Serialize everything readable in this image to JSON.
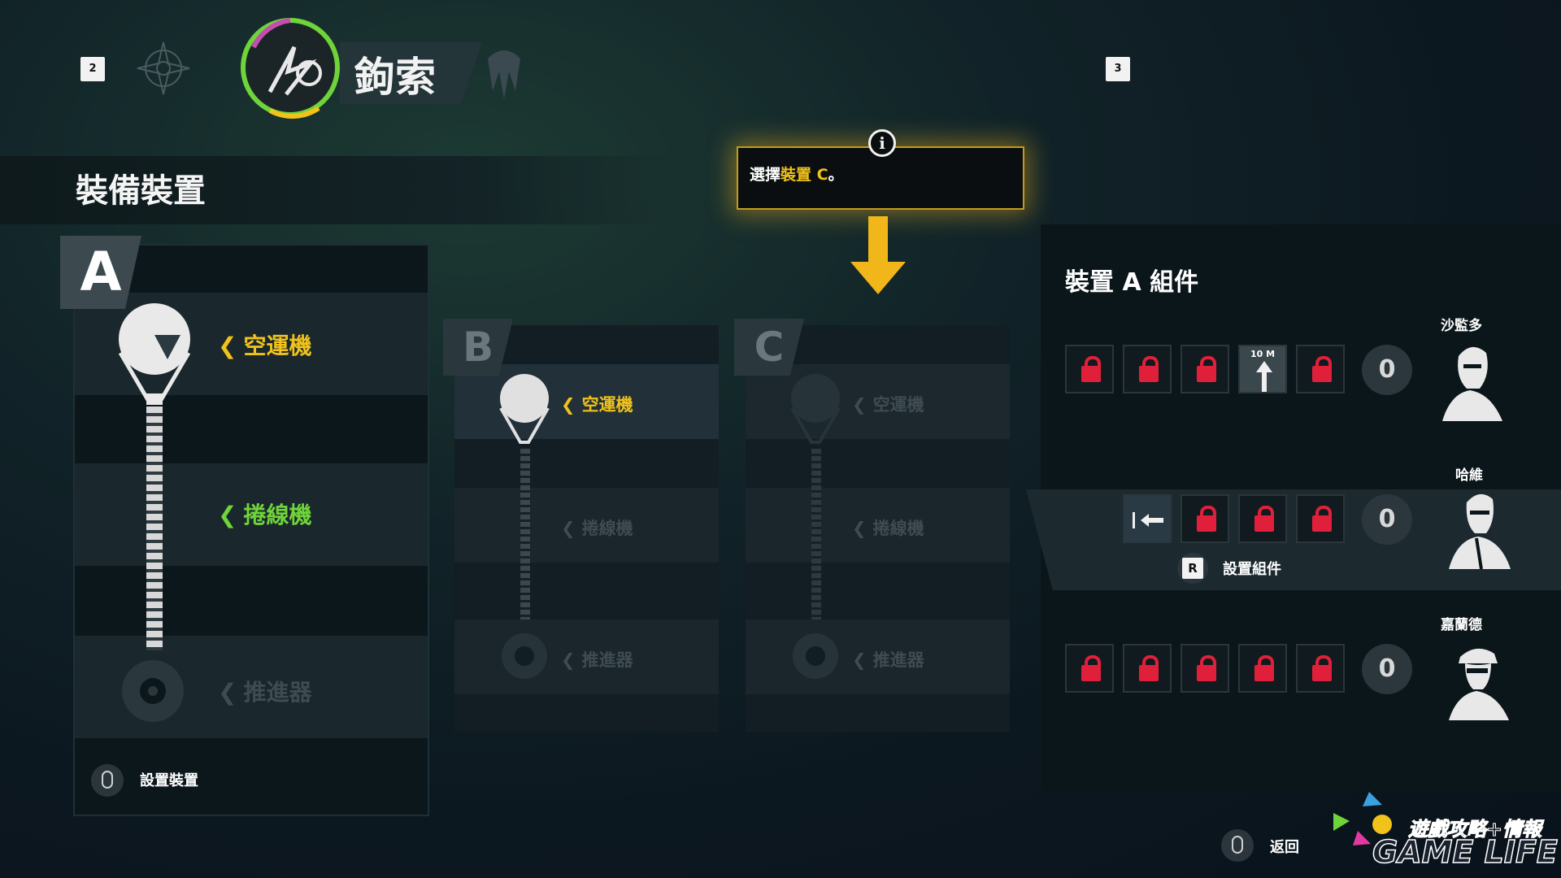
{
  "header": {
    "key_left": "2",
    "key_right": "3",
    "title": "鉤索"
  },
  "section_title": "裝備裝置",
  "tooltip": {
    "prefix": "選擇",
    "highlight": "裝置 C",
    "suffix": "。"
  },
  "device_a": {
    "letter": "A",
    "slots": [
      {
        "label": "空運機",
        "state": "yellow"
      },
      {
        "label": "捲線機",
        "state": "green"
      },
      {
        "label": "推進器",
        "state": "dim"
      }
    ],
    "hint": "設置裝置"
  },
  "device_b": {
    "letter": "B",
    "slots": [
      {
        "label": "空運機",
        "state": "yellow"
      },
      {
        "label": "捲線機",
        "state": "dim"
      },
      {
        "label": "推進器",
        "state": "dim"
      }
    ]
  },
  "device_c": {
    "letter": "C",
    "slots": [
      {
        "label": "空運機",
        "state": "dim"
      },
      {
        "label": "捲線機",
        "state": "dim"
      },
      {
        "label": "推進器",
        "state": "dim"
      }
    ]
  },
  "components": {
    "title": "裝置 A 組件",
    "rows": [
      {
        "name": "沙監多",
        "count": "0",
        "first_slot_label": "10 M"
      },
      {
        "name": "哈維",
        "count": "0",
        "hint_key": "R",
        "hint_label": "設置組件"
      },
      {
        "name": "嘉蘭德",
        "count": "0"
      }
    ]
  },
  "footer": {
    "back_label": "返回",
    "watermark_line1": "遊戲攻略+情報",
    "watermark_line2": "GAME LIFE"
  },
  "colors": {
    "accent_yellow": "#f0c21a",
    "accent_green": "#6fd33a",
    "lock_red": "#e0203a"
  }
}
